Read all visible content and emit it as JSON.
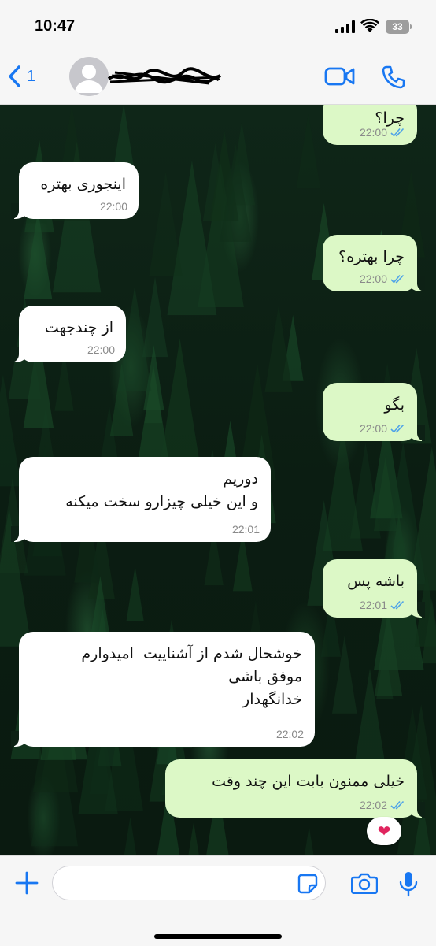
{
  "status_bar": {
    "time": "10:47",
    "battery": "33"
  },
  "header": {
    "back_count": "1",
    "contact_name": ""
  },
  "messages": [
    {
      "dir": "out",
      "text": "چرا؟",
      "time": "22:00"
    },
    {
      "dir": "in",
      "text": "اینجوری بهتره",
      "time": "22:00"
    },
    {
      "dir": "out",
      "text": "چرا بهتره؟",
      "time": "22:00"
    },
    {
      "dir": "in",
      "text": "از چندجهت",
      "time": "22:00"
    },
    {
      "dir": "out",
      "text": "بگو",
      "time": "22:00"
    },
    {
      "dir": "in",
      "text": "دوریم\nو این خیلی چیزارو سخت میکنه",
      "time": "22:01"
    },
    {
      "dir": "out",
      "text": "باشه پس",
      "time": "22:01"
    },
    {
      "dir": "in",
      "text": "خوشحال شدم از آشناییت  امیدوارم\nموفق باشی\nخدانگهدار",
      "time": "22:02"
    },
    {
      "dir": "out",
      "text": "خیلی ممنون بابت این چند وقت",
      "time": "22:02"
    }
  ],
  "reaction": "❤",
  "composer": {
    "placeholder": ""
  },
  "colors": {
    "accent": "#1877f2",
    "outgoing_bubble": "#dcf8c6",
    "incoming_bubble": "#ffffff",
    "read_ticks": "#4fa3e8"
  }
}
